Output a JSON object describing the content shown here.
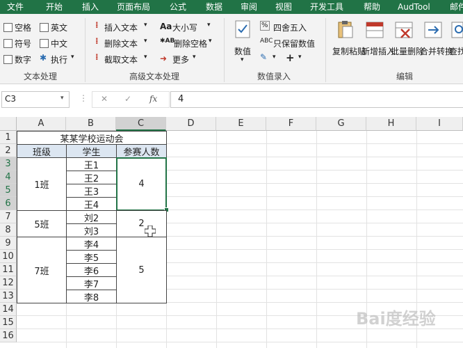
{
  "tabs": [
    "文件",
    "开始",
    "插入",
    "页面布局",
    "公式",
    "数据",
    "审阅",
    "视图",
    "开发工具",
    "帮助",
    "AudTool",
    "邮件"
  ],
  "ribbon": {
    "text_group": {
      "checks": [
        "空格",
        "英文",
        "符号",
        "中文",
        "数字"
      ],
      "execute_label": "执行",
      "label": "文本处理"
    },
    "advanced_group": {
      "items": [
        "插入文本",
        "删除文本",
        "截取文本",
        "大小写",
        "删除空格",
        "更多"
      ],
      "label": "高级文本处理"
    },
    "numeric_group": {
      "numeric_label": "数值",
      "round_label": "四舍五入",
      "keep_label": "只保留数值",
      "label": "数值录入"
    },
    "edit_group": {
      "buttons": [
        "复制粘贴",
        "新增插入",
        "批量删除",
        "合并转换",
        "查找定位"
      ],
      "label": "编辑"
    }
  },
  "formula_bar": {
    "name_box": "C3",
    "cancel": "✕",
    "confirm": "✓",
    "fx": "fx",
    "value": "4"
  },
  "sheet": {
    "columns": [
      "A",
      "B",
      "C",
      "D",
      "E",
      "F",
      "G",
      "H",
      "I"
    ],
    "rows": [
      "1",
      "2",
      "3",
      "4",
      "5",
      "6",
      "7",
      "8",
      "9",
      "10",
      "11",
      "12",
      "13",
      "14",
      "15",
      "16"
    ],
    "title": "某某学校运动会",
    "headers": [
      "班级",
      "学生",
      "参赛人数"
    ],
    "classes": [
      "1班",
      "5班",
      "7班"
    ],
    "students": [
      "王1",
      "王2",
      "王3",
      "王4",
      "刘2",
      "刘3",
      "李4",
      "李5",
      "李6",
      "李7",
      "李8"
    ],
    "counts": [
      "4",
      "2",
      "5"
    ]
  },
  "watermark": "Bai度经验",
  "colors": {
    "ribbon_tab": "#217346",
    "selection": "#217346",
    "header_fill": "#dce6f1"
  }
}
